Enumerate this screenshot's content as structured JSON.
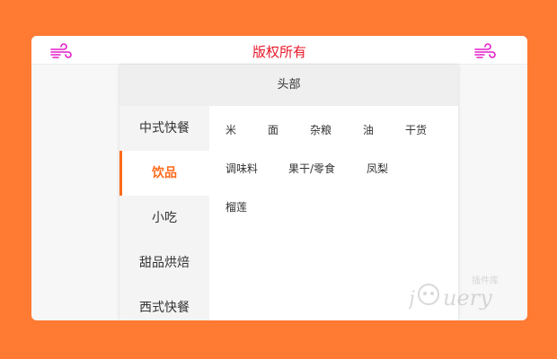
{
  "header": {
    "title": "版权所有",
    "left_icon": "wind-icon",
    "right_icon": "wind-icon",
    "accent_color": "#e8182a",
    "icon_color": "#e21ec8"
  },
  "panel": {
    "header_label": "头部"
  },
  "categories": [
    {
      "label": "中式快餐"
    },
    {
      "label": "饮品",
      "active": true
    },
    {
      "label": "小吃"
    },
    {
      "label": "甜品烘焙"
    },
    {
      "label": "西式快餐"
    }
  ],
  "subitems": [
    "米",
    "面",
    "杂粮",
    "油",
    "干货",
    "调味料",
    "果干/零食",
    "凤梨",
    "榴莲"
  ],
  "theme": {
    "background": "#ff7a33",
    "active_color": "#ff6a1a"
  },
  "watermark": {
    "brand": "jQuery",
    "tag": "插件库"
  }
}
